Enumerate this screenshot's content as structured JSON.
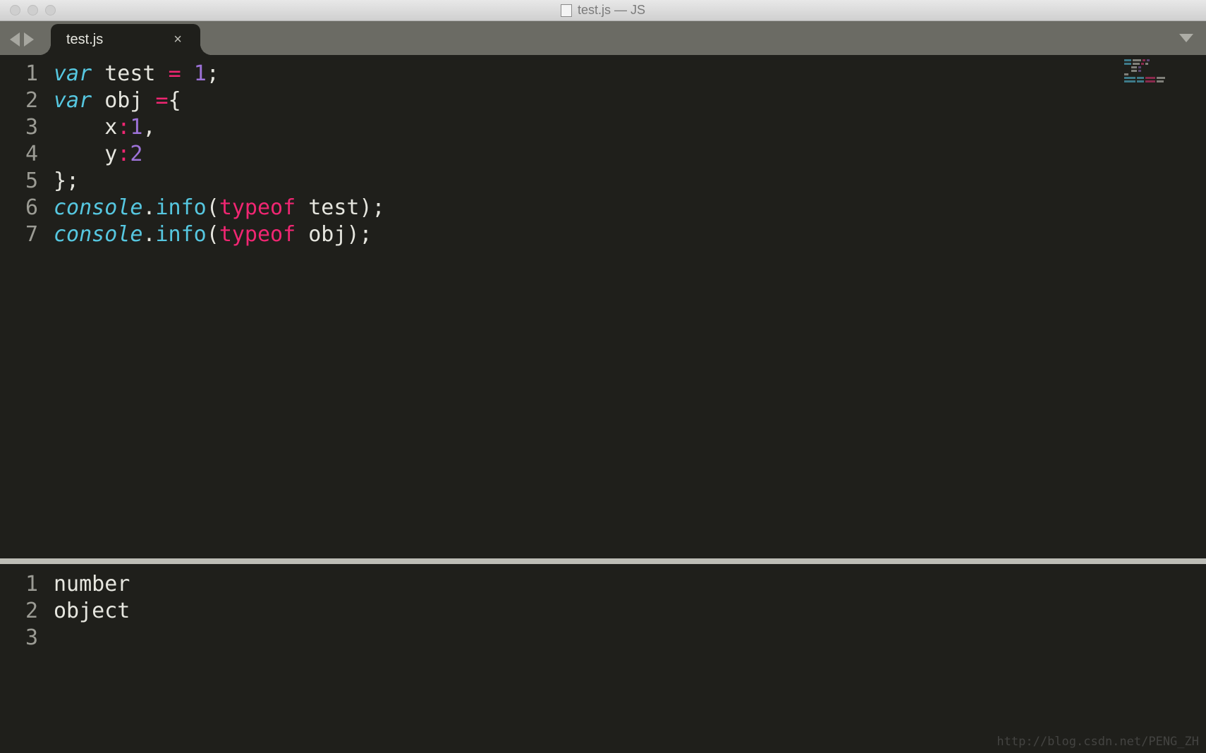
{
  "window": {
    "title": "test.js — JS"
  },
  "tabs": [
    {
      "label": "test.js",
      "close": "×",
      "active": true
    }
  ],
  "editor": {
    "line_numbers": [
      "1",
      "2",
      "3",
      "4",
      "5",
      "6",
      "7"
    ],
    "lines": [
      [
        {
          "cls": "kw-storage",
          "t": "var"
        },
        {
          "cls": "ident",
          "t": " test "
        },
        {
          "cls": "op",
          "t": "="
        },
        {
          "cls": "ident",
          "t": " "
        },
        {
          "cls": "num",
          "t": "1"
        },
        {
          "cls": "punct",
          "t": ";"
        }
      ],
      [
        {
          "cls": "kw-storage",
          "t": "var"
        },
        {
          "cls": "ident",
          "t": " obj "
        },
        {
          "cls": "op",
          "t": "="
        },
        {
          "cls": "punct",
          "t": "{"
        }
      ],
      [
        {
          "cls": "ident",
          "t": "    x"
        },
        {
          "cls": "op",
          "t": ":"
        },
        {
          "cls": "num",
          "t": "1"
        },
        {
          "cls": "punct",
          "t": ","
        }
      ],
      [
        {
          "cls": "ident",
          "t": "    y"
        },
        {
          "cls": "op",
          "t": ":"
        },
        {
          "cls": "num",
          "t": "2"
        }
      ],
      [
        {
          "cls": "punct",
          "t": "};"
        }
      ],
      [
        {
          "cls": "obj-call",
          "t": "console"
        },
        {
          "cls": "punct",
          "t": "."
        },
        {
          "cls": "method",
          "t": "info"
        },
        {
          "cls": "punct",
          "t": "("
        },
        {
          "cls": "kw-op",
          "t": "typeof"
        },
        {
          "cls": "ident",
          "t": " test"
        },
        {
          "cls": "punct",
          "t": ");"
        }
      ],
      [
        {
          "cls": "obj-call",
          "t": "console"
        },
        {
          "cls": "punct",
          "t": "."
        },
        {
          "cls": "method",
          "t": "info"
        },
        {
          "cls": "punct",
          "t": "("
        },
        {
          "cls": "kw-op",
          "t": "typeof"
        },
        {
          "cls": "ident",
          "t": " obj"
        },
        {
          "cls": "punct",
          "t": ");"
        }
      ]
    ]
  },
  "console": {
    "line_numbers": [
      "1",
      "2",
      "3"
    ],
    "lines": [
      "number",
      "object",
      ""
    ]
  },
  "watermark": "http://blog.csdn.net/PENG_ZH"
}
